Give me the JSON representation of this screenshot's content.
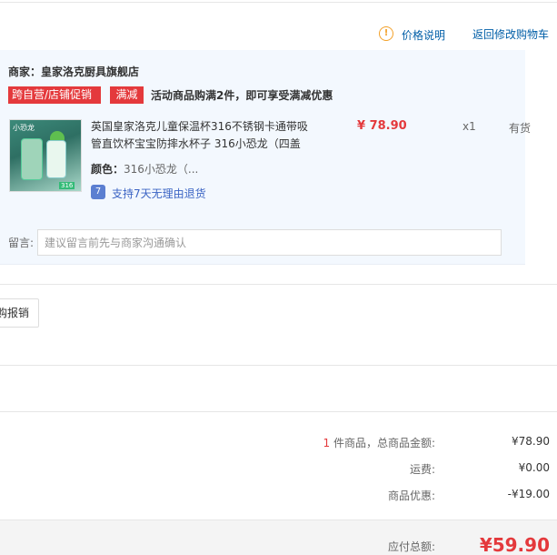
{
  "links": {
    "price_note": "价格说明",
    "back_to_cart": "返回修改购物车"
  },
  "shop": {
    "merchant_label": "商家：",
    "merchant_name": "皇家洛克厨具旗舰店",
    "tag_cross": "跨自营/店铺促销",
    "tag_discount": "满减",
    "promo_text": "活动商品购满2件，即可享受满减优惠"
  },
  "item": {
    "thumb_label": "小恐龙",
    "thumb_badge": "316",
    "title": "英国皇家洛克儿童保温杯316不锈钢卡通带吸管直饮杯宝宝防摔水杯子 316小恐龙（四盖",
    "price": "¥ 78.90",
    "qty": "x1",
    "stock": "有货",
    "color_label": "颜色：",
    "color_value": "316小恐龙（...",
    "return_icon": "7",
    "return_text": "支持7天无理由退货"
  },
  "note": {
    "label": "留言:",
    "placeholder": "建议留言前先与商家沟通确认"
  },
  "reimburse": {
    "label": "购报销"
  },
  "summary": {
    "count": "1",
    "count_suffix": " 件商品，总商品金额:",
    "goods_total": "¥78.90",
    "shipping_label": "运费:",
    "shipping": "¥0.00",
    "discount_label": "商品优惠:",
    "discount": "-¥19.00",
    "total_label": "应付总额:",
    "total": "¥59.90"
  },
  "colors": {
    "accent_red": "#e4393c",
    "link_blue": "#005ea7",
    "shop_bg": "#f3f8fe",
    "warn_orange": "#f3a12a"
  }
}
